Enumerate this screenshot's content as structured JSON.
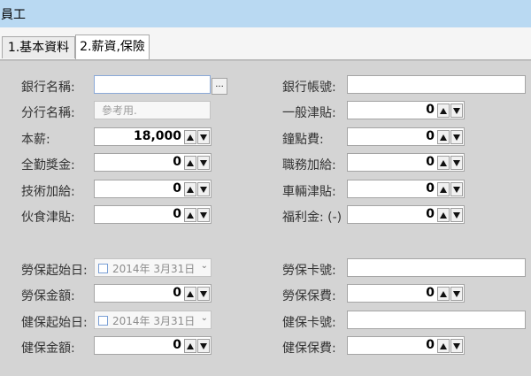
{
  "window": {
    "title": "員工"
  },
  "tabs": [
    {
      "label": "1.基本資料"
    },
    {
      "label": "2.薪資,保險"
    }
  ],
  "left": {
    "bank_name": {
      "label": "銀行名稱:",
      "value": "",
      "button": "..."
    },
    "branch_name": {
      "label": "分行名稱:",
      "placeholder": "參考用."
    },
    "base_salary": {
      "label": "本薪:",
      "value": "18,000"
    },
    "attendance_bonus": {
      "label": "全勤獎金:",
      "value": "0"
    },
    "skill_allowance": {
      "label": "技術加給:",
      "value": "0"
    },
    "meal_allowance": {
      "label": "伙食津貼:",
      "value": "0"
    },
    "labor_start": {
      "label": "勞保起始日:",
      "value": "2014年  3月31日"
    },
    "labor_amount": {
      "label": "勞保金額:",
      "value": "0"
    },
    "health_start": {
      "label": "健保起始日:",
      "value": "2014年  3月31日"
    },
    "health_amount": {
      "label": "健保金額:",
      "value": "0"
    }
  },
  "right": {
    "bank_account": {
      "label": "銀行帳號:",
      "value": ""
    },
    "general_allowance": {
      "label": "一般津貼:",
      "value": "0"
    },
    "hourly_fee": {
      "label": "鐘點費:",
      "value": "0"
    },
    "duty_allowance": {
      "label": "職務加給:",
      "value": "0"
    },
    "vehicle_allowance": {
      "label": "車輛津貼:",
      "value": "0"
    },
    "welfare": {
      "label": "福利金: (-)",
      "value": "0"
    },
    "labor_card": {
      "label": "勞保卡號:",
      "value": ""
    },
    "labor_fee": {
      "label": "勞保保費:",
      "value": "0"
    },
    "health_card": {
      "label": "健保卡號:",
      "value": ""
    },
    "health_fee": {
      "label": "健保保費:",
      "value": "0"
    }
  }
}
